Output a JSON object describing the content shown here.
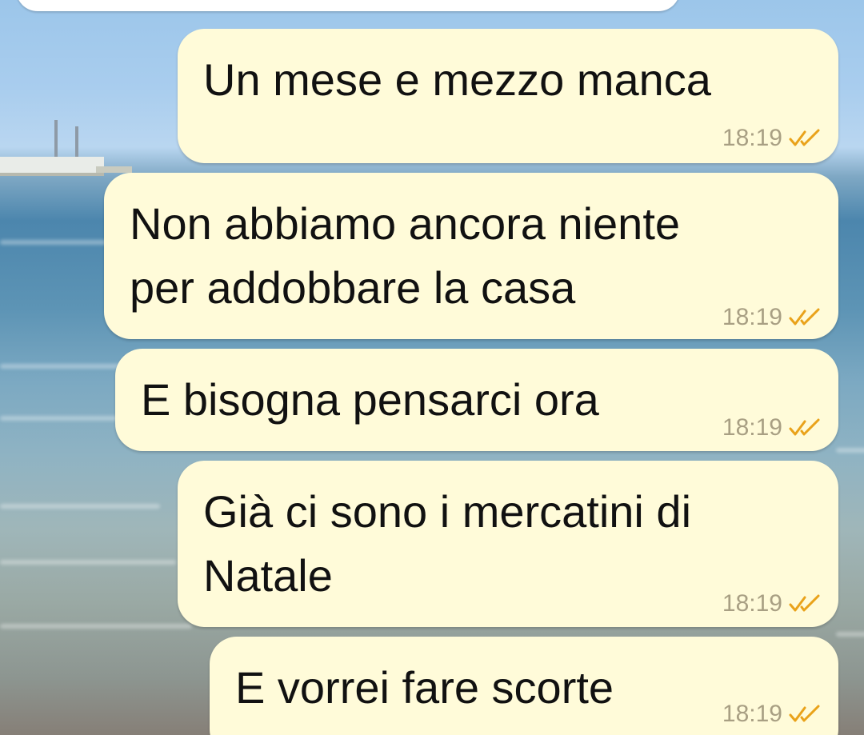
{
  "theme": {
    "bubble_color": "#fffbd9",
    "tick_color": "#e9a21a"
  },
  "messages": [
    {
      "text": "Un mese e mezzo manca",
      "time": "18:19",
      "status": "read"
    },
    {
      "text": "Non abbiamo ancora niente\nper addobbare la casa",
      "time": "18:19",
      "status": "read"
    },
    {
      "text": "E bisogna pensarci ora",
      "time": "18:19",
      "status": "read"
    },
    {
      "text": "Già ci sono i mercatini di\nNatale",
      "time": "18:19",
      "status": "read"
    },
    {
      "text": "E vorrei fare scorte",
      "time": "18:19",
      "status": "read"
    }
  ]
}
